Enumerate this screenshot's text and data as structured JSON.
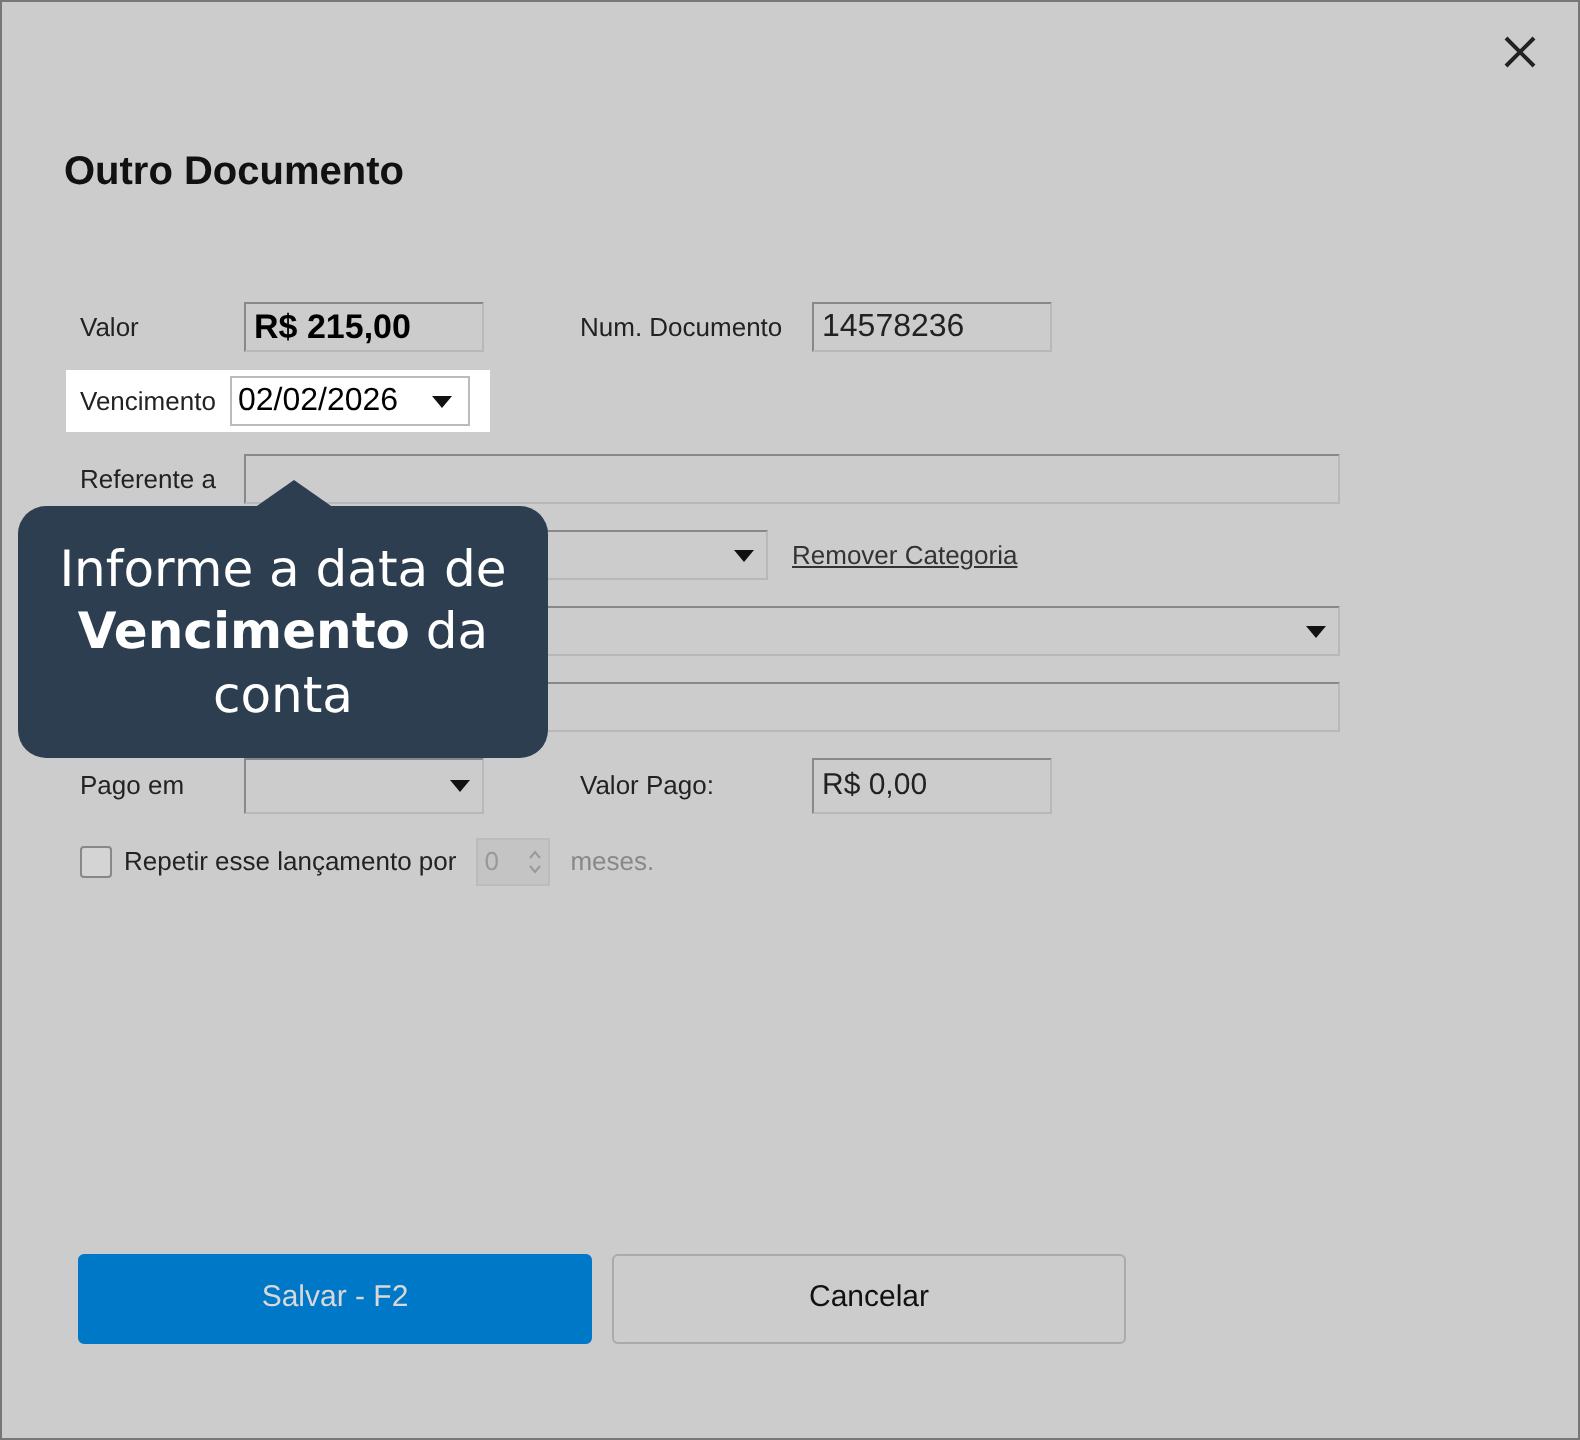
{
  "dialog": {
    "title": "Outro Documento"
  },
  "valor": {
    "label": "Valor",
    "value": "R$ 215,00"
  },
  "num_documento": {
    "label": "Num. Documento",
    "value": "14578236"
  },
  "vencimento": {
    "label": "Vencimento",
    "value": "02/02/2026",
    "highlighted": true
  },
  "referente": {
    "label": "Referente a"
  },
  "categoria": {
    "link": "Remover Categoria"
  },
  "pago_em": {
    "label": "Pago em"
  },
  "valor_pago": {
    "label": "Valor Pago:",
    "value": "R$ 0,00"
  },
  "repetir": {
    "label": "Repetir esse lançamento por",
    "checked": false,
    "count": "0",
    "unit": "meses."
  },
  "tooltip": {
    "text": "Informe a data de **Vencimento** da conta"
  },
  "buttons": [
    {
      "label": "Salvar - F2",
      "kind": "primary"
    },
    {
      "label": "Cancelar",
      "kind": "secondary"
    }
  ]
}
